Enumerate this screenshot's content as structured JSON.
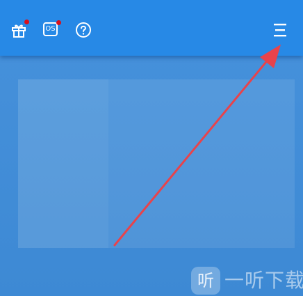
{
  "toolbar": {
    "gift_icon": "gift-icon",
    "os_icon": "os-icon",
    "os_label": "OS",
    "help_icon": "help-icon",
    "menu_icon": "menu-icon",
    "notification_color": "#d80f1c"
  },
  "annotation": {
    "arrow_color": "#e8434b"
  },
  "watermark": {
    "logo_glyph": "听",
    "text": "一听下载"
  },
  "colors": {
    "header": "#2789e6",
    "background": "#3f8fdc"
  }
}
